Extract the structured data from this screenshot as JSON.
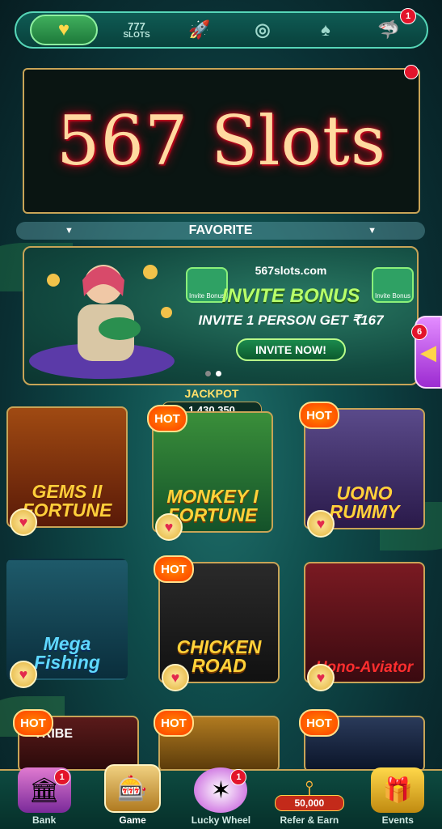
{
  "topnav": {
    "items": [
      {
        "id": "favorites",
        "icon": "heart-icon"
      },
      {
        "id": "slots",
        "icon": "slots-icon",
        "line1": "777",
        "line2": "SLOTS"
      },
      {
        "id": "crash",
        "icon": "rocket-icon"
      },
      {
        "id": "roulette",
        "icon": "roulette-icon"
      },
      {
        "id": "cards",
        "icon": "cards-icon"
      },
      {
        "id": "fishing",
        "icon": "shark-icon",
        "badge": "1"
      }
    ]
  },
  "title_panel": {
    "text": "567 Slots"
  },
  "favorite_bar": {
    "label": "FAVORITE"
  },
  "invite_banner": {
    "site": "567slots.com",
    "headline": "INVITE BONUS",
    "subline": "INVITE 1 PERSON GET ₹167",
    "button": "INVITE NOW!",
    "mini_label": "Invite Bonus"
  },
  "side_tab": {
    "badge": "6"
  },
  "jackpot": {
    "label": "JACKPOT",
    "value": "1,430,350"
  },
  "games": [
    {
      "name": "GEMS II FORTUNE",
      "hot": false,
      "hot_label": "HOT",
      "color": "#ffcf3a",
      "bg": "#6b2a10"
    },
    {
      "name": "MONKEY I FORTUNE",
      "hot": true,
      "hot_label": "HOT",
      "color": "#ffd23a",
      "bg": "#1d6a2e"
    },
    {
      "name": "UONO RUMMY",
      "hot": true,
      "hot_label": "HOT",
      "color": "#ffd23a",
      "bg": "#3a2b5a"
    },
    {
      "name": "Mega Fishing",
      "hot": false,
      "hot_label": "HOT",
      "color": "#5fd8ff",
      "bg": "#0e3b55"
    },
    {
      "name": "CHICKEN ROAD",
      "hot": true,
      "hot_label": "HOT",
      "color": "#ffd23a",
      "bg": "#1a1a1a"
    },
    {
      "name": "Uono-Aviator",
      "hot": false,
      "hot_label": "HOT",
      "color": "#ff2e2e",
      "bg": "#5a0d16"
    },
    {
      "name": "TRIBE",
      "hot": true,
      "hot_label": "HOT",
      "color": "#ffffff",
      "bg": "#4a1214"
    },
    {
      "name": "",
      "hot": true,
      "hot_label": "HOT",
      "color": "#ffffff",
      "bg": "#7a4a12"
    },
    {
      "name": "",
      "hot": true,
      "hot_label": "HOT",
      "color": "#ffffff",
      "bg": "#14233c"
    }
  ],
  "bottomnav": {
    "items": [
      {
        "label": "Bank",
        "icon": "bank-icon",
        "badge": "1"
      },
      {
        "label": "Game",
        "icon": "slot-machine-icon",
        "active": true
      },
      {
        "label": "Lucky Wheel",
        "icon": "wheel-icon",
        "badge": "1"
      },
      {
        "label": "Refer & Earn",
        "icon": "share-icon",
        "value": "50,000"
      },
      {
        "label": "Events",
        "icon": "gift-icon"
      }
    ]
  }
}
